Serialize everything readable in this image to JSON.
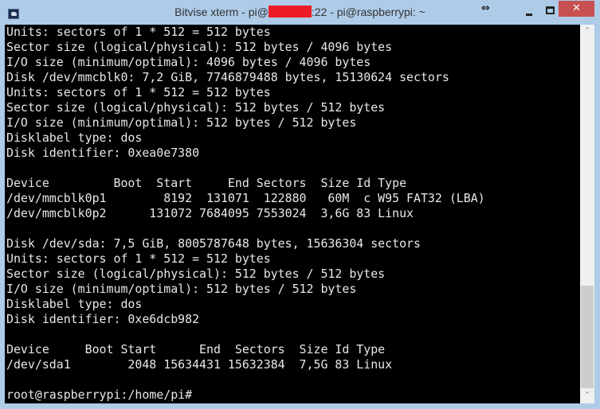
{
  "window": {
    "title_prefix": "Bitvise xterm - pi@",
    "title_suffix": ":22 - pi@raspberrypi: ~",
    "redaction_color": "#ed1c24",
    "controls": {
      "resize_glyph": "⇔",
      "minimize_label": "",
      "maximize_label": "",
      "close_glyph": "✕"
    }
  },
  "terminal": {
    "background": "#000000",
    "foreground": "#e8e8e8",
    "lines": [
      "Units: sectors of 1 * 512 = 512 bytes",
      "Sector size (logical/physical): 512 bytes / 4096 bytes",
      "I/O size (minimum/optimal): 4096 bytes / 4096 bytes",
      "Disk /dev/mmcblk0: 7,2 GiB, 7746879488 bytes, 15130624 sectors",
      "Units: sectors of 1 * 512 = 512 bytes",
      "Sector size (logical/physical): 512 bytes / 512 bytes",
      "I/O size (minimum/optimal): 512 bytes / 512 bytes",
      "Disklabel type: dos",
      "Disk identifier: 0xea0e7380",
      "",
      "Device         Boot  Start     End Sectors  Size Id Type",
      "/dev/mmcblk0p1        8192  131071  122880   60M  c W95 FAT32 (LBA)",
      "/dev/mmcblk0p2      131072 7684095 7553024  3,6G 83 Linux",
      "",
      "Disk /dev/sda: 7,5 GiB, 8005787648 bytes, 15636304 sectors",
      "Units: sectors of 1 * 512 = 512 bytes",
      "Sector size (logical/physical): 512 bytes / 512 bytes",
      "I/O size (minimum/optimal): 512 bytes / 512 bytes",
      "Disklabel type: dos",
      "Disk identifier: 0xe6dcb982",
      "",
      "Device     Boot Start      End  Sectors  Size Id Type",
      "/dev/sda1        2048 15634431 15632384  7,5G 83 Linux",
      "",
      "root@raspberrypi:/home/pi# "
    ]
  },
  "scrollbar": {
    "up_glyph": "˄",
    "down_glyph": "˅",
    "thumb_start_fraction": 0.69,
    "thumb_end_fraction": 0.96
  }
}
